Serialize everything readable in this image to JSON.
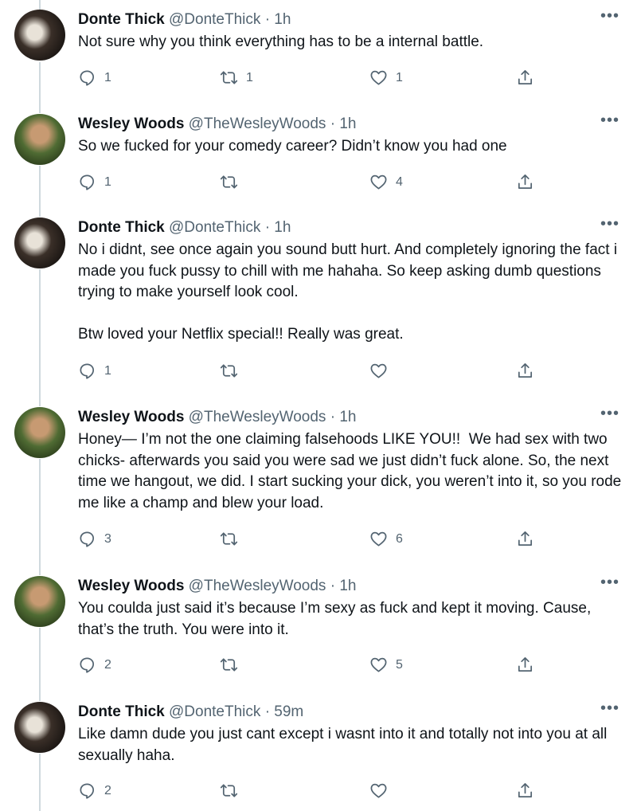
{
  "tweets": [
    {
      "name": "Donte Thick",
      "handle": "@DonteThick",
      "dot": "·",
      "time": "1h",
      "more": "•••",
      "avatar_icon": "profile-photo-donte",
      "text": "Not sure why you think everything has to be a internal battle.",
      "replies": "1",
      "retweets": "1",
      "likes": "1"
    },
    {
      "name": "Wesley Woods",
      "handle": "@TheWesleyWoods",
      "dot": "·",
      "time": "1h",
      "more": "•••",
      "avatar_icon": "profile-photo-wesley",
      "text": "So we fucked for your comedy career? Didn’t know you had one",
      "replies": "1",
      "retweets": "",
      "likes": "4"
    },
    {
      "name": "Donte Thick",
      "handle": "@DonteThick",
      "dot": "·",
      "time": "1h",
      "more": "•••",
      "avatar_icon": "profile-photo-donte",
      "text": "No i didnt, see once again you sound butt hurt. And completely ignoring the fact i made you fuck pussy to chill with me hahaha. So keep asking dumb questions trying to make yourself look cool.\n\nBtw loved your Netflix special!! Really was great.",
      "replies": "1",
      "retweets": "",
      "likes": ""
    },
    {
      "name": "Wesley Woods",
      "handle": "@TheWesleyWoods",
      "dot": "·",
      "time": "1h",
      "more": "•••",
      "avatar_icon": "profile-photo-wesley",
      "text": "Honey— I’m not the one claiming falsehoods LIKE YOU!!  We had sex with two chicks- afterwards you said you were sad we just didn’t fuck alone. So, the next time we hangout, we did. I start sucking your dick, you weren’t into it, so you rode me like a champ and blew your load.",
      "replies": "3",
      "retweets": "",
      "likes": "6"
    },
    {
      "name": "Wesley Woods",
      "handle": "@TheWesleyWoods",
      "dot": "·",
      "time": "1h",
      "more": "•••",
      "avatar_icon": "profile-photo-wesley",
      "text": "You coulda just said it’s because I’m sexy as fuck and kept it moving. Cause, that’s the truth. You were into it.",
      "replies": "2",
      "retweets": "",
      "likes": "5"
    },
    {
      "name": "Donte Thick",
      "handle": "@DonteThick",
      "dot": "·",
      "time": "59m",
      "more": "•••",
      "avatar_icon": "profile-photo-donte",
      "text": "Like damn dude you just cant except i wasnt into it and totally not into you at all sexually haha.",
      "replies": "2",
      "retweets": "",
      "likes": ""
    }
  ],
  "icons": {
    "reply": "reply-icon",
    "retweet": "retweet-icon",
    "like": "heart-icon",
    "share": "share-icon",
    "more": "more-icon"
  },
  "colors": {
    "text": "#0f1419",
    "secondary": "#536471",
    "thread_line": "#cfd9de"
  }
}
